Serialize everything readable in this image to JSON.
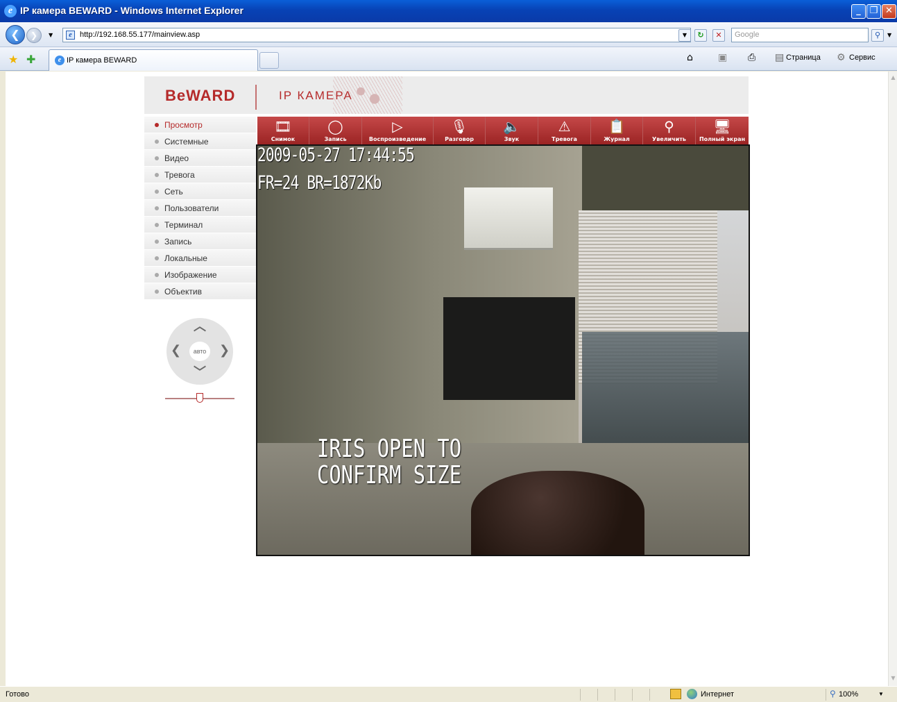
{
  "window": {
    "title": "IP камера BEWARD - Windows Internet Explorer",
    "minimize": "_",
    "restore": "❐",
    "close": "✕"
  },
  "address": {
    "url": "http://192.168.55.177/mainview.asp",
    "search_placeholder": "Google"
  },
  "tabs": [
    {
      "label": "IP камера BEWARD"
    }
  ],
  "commandbar": {
    "page": "Страница",
    "tools": "Сервис"
  },
  "header": {
    "logo": "BeWARD",
    "title": "IP КАМЕРА"
  },
  "menu": [
    {
      "label": "Просмотр",
      "active": true
    },
    {
      "label": "Системные"
    },
    {
      "label": "Видео"
    },
    {
      "label": "Тревога"
    },
    {
      "label": "Сеть"
    },
    {
      "label": "Пользователи"
    },
    {
      "label": "Терминал"
    },
    {
      "label": "Запись"
    },
    {
      "label": "Локальные"
    },
    {
      "label": "Изображение"
    },
    {
      "label": "Объектив"
    }
  ],
  "ptz": {
    "auto": "авто"
  },
  "toolbar": [
    {
      "label": "Снимок",
      "icon": "film-icon"
    },
    {
      "label": "Запись",
      "icon": "record-icon"
    },
    {
      "label": "Воспроизведение",
      "icon": "play-icon"
    },
    {
      "label": "Разговор",
      "icon": "microphone-icon"
    },
    {
      "label": "Звук",
      "icon": "speaker-icon"
    },
    {
      "label": "Тревога",
      "icon": "alarm-icon"
    },
    {
      "label": "Журнал",
      "icon": "clipboard-icon"
    },
    {
      "label": "Увеличить",
      "icon": "magnifier-icon"
    },
    {
      "label": "Полный экран",
      "icon": "monitor-icon"
    }
  ],
  "video": {
    "timestamp": "2009-05-27 17:44:55",
    "stats": "FR=24 BR=1872Kb",
    "message_line1": "IRIS OPEN TO",
    "message_line2": "CONFIRM SIZE"
  },
  "status": {
    "text": "Готово",
    "zone": "Интернет",
    "zoom": "100%"
  },
  "colors": {
    "brand": "#b52a2a",
    "toolbar": "#b03535",
    "titlebar": "#0a4fc6"
  }
}
